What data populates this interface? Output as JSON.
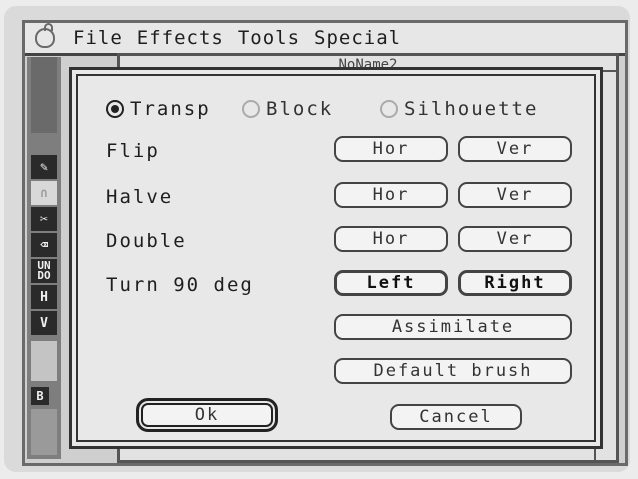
{
  "menu": {
    "items": [
      "File",
      "Effects",
      "Tools",
      "Special"
    ]
  },
  "window": {
    "title": "NoName2"
  },
  "toolbar": {
    "undo_label": "UN\nDO",
    "h_label": "H",
    "v_label": "V",
    "b_label": "B"
  },
  "dialog": {
    "mode_options": [
      {
        "label": "Transp",
        "selected": true
      },
      {
        "label": "Block",
        "selected": false
      },
      {
        "label": "Silhouette",
        "selected": false
      }
    ],
    "rows": [
      {
        "label": "Flip",
        "left": "Hor",
        "right": "Ver"
      },
      {
        "label": "Halve",
        "left": "Hor",
        "right": "Ver"
      },
      {
        "label": "Double",
        "left": "Hor",
        "right": "Ver"
      },
      {
        "label": "Turn 90 deg",
        "left": "Left",
        "right": "Right"
      }
    ],
    "assimilate_label": "Assimilate",
    "default_brush_label": "Default brush",
    "ok_label": "Ok",
    "cancel_label": "Cancel"
  }
}
